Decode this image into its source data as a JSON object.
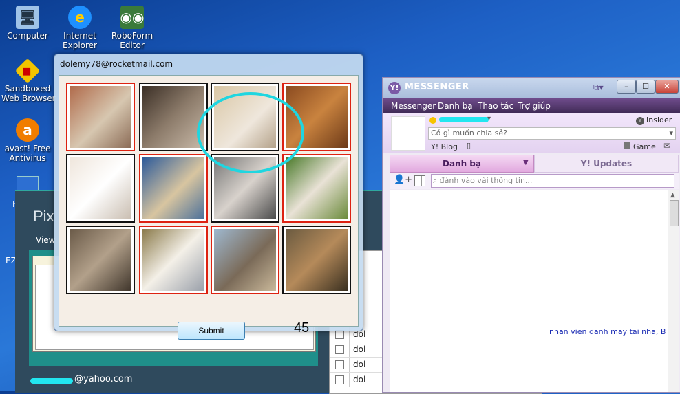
{
  "desktop": {
    "icons": [
      {
        "label": "Computer",
        "icon": "computer-icon"
      },
      {
        "label": "Internet\nExplorer",
        "icon": "internet-explorer-icon"
      },
      {
        "label": "RoboForm\nEditor",
        "icon": "roboform-icon"
      },
      {
        "label": "Sandboxed\nWeb Browser",
        "icon": "sandboxie-icon"
      },
      {
        "label": "avast! Free\nAntivirus",
        "icon": "avast-icon"
      }
    ],
    "partial_labels": [
      "F",
      "EZ"
    ]
  },
  "pix_window": {
    "title": "Pix",
    "view_tab": "View",
    "minimize": "–",
    "maximize": "☐",
    "close": "✕",
    "email": "@yahoo.com",
    "list_rows": [
      "dol",
      "dol",
      "dol",
      "dol"
    ]
  },
  "messenger": {
    "title": "MESSENGER",
    "menu": [
      "Messenger",
      "Danh bạ",
      "Thao tác",
      "Trợ giúp"
    ],
    "status_placeholder": "Có gì muốn chia sẻ?",
    "insider": "Insider",
    "blog": "Y! Blog",
    "game": "Game",
    "tabs": [
      "Danh bạ",
      "Y! Updates"
    ],
    "search_placeholder": "đánh vào vài thông tin...",
    "message_snippet": "nhan vien danh may tai nha, B ..."
  },
  "captcha_dialog": {
    "title": "dolemy78@rocketmail.com",
    "submit_label": "Submit",
    "count": "45",
    "tiles": [
      {
        "subject": "cat",
        "selected": true
      },
      {
        "subject": "cat",
        "selected": false
      },
      {
        "subject": "cat",
        "selected": false
      },
      {
        "subject": "dog",
        "selected": true
      },
      {
        "subject": "cat",
        "selected": false
      },
      {
        "subject": "dog",
        "selected": true
      },
      {
        "subject": "cat",
        "selected": false
      },
      {
        "subject": "dog",
        "selected": true
      },
      {
        "subject": "cat",
        "selected": false
      },
      {
        "subject": "dog",
        "selected": true
      },
      {
        "subject": "dog",
        "selected": true
      },
      {
        "subject": "cat",
        "selected": false
      }
    ]
  },
  "colors": {
    "selected_border": "#d21",
    "highlight_circle": "#1fd6e0",
    "messenger_accent": "#6f4c8c"
  }
}
